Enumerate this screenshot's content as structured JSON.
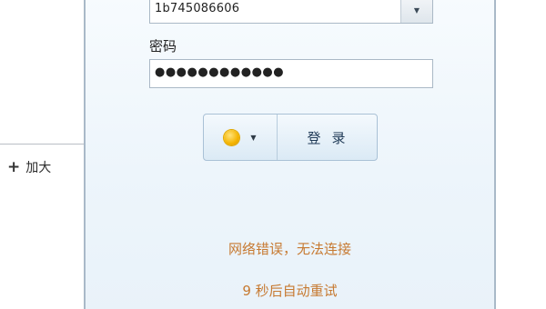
{
  "zoom": {
    "icon": "plus-icon",
    "label": "加大"
  },
  "login": {
    "account_value": "1b745086606",
    "account_dropdown_icon": "chevron-down-icon",
    "password_label": "密码",
    "password_value": "●●●●●●●●●●●●",
    "status_icon": "online-status-icon",
    "status_color": "#f4b400",
    "status_dropdown_icon": "chevron-down-icon",
    "login_label": "登录"
  },
  "messages": {
    "error": "网络错误，无法连接",
    "retry": "9 秒后自动重试"
  }
}
